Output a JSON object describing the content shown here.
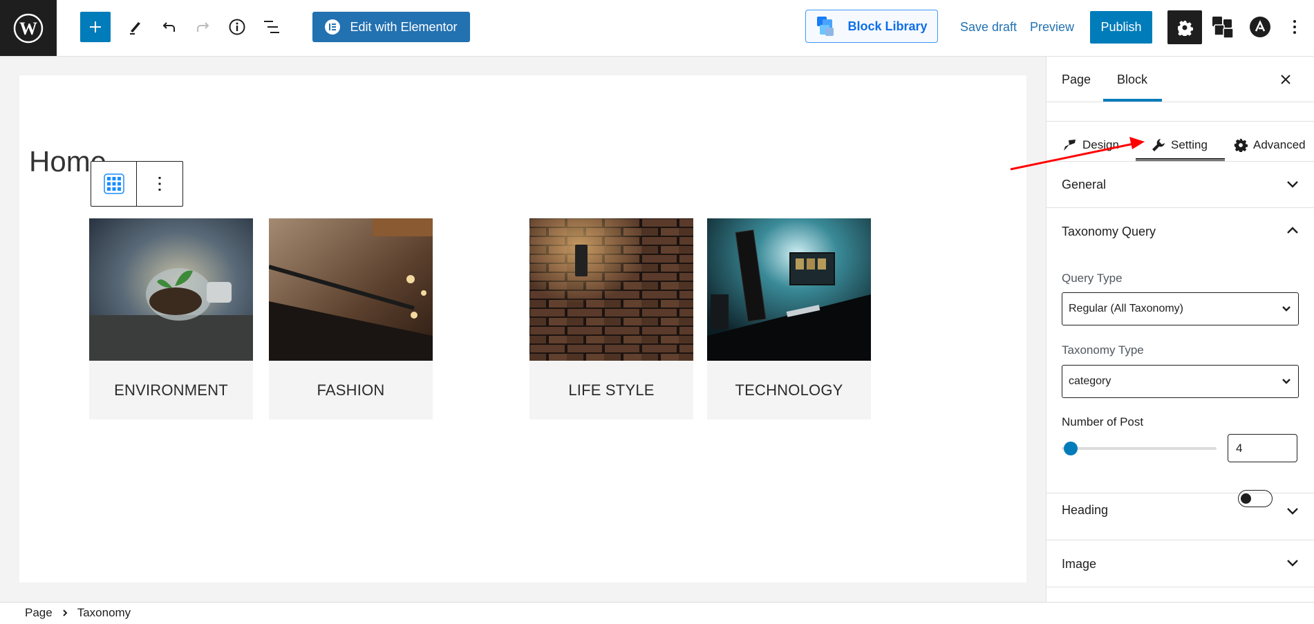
{
  "header": {
    "logo_icon": "wordpress-logo-icon",
    "toolbar_icons": [
      "plus-icon",
      "pen-icon",
      "undo-icon",
      "redo-icon",
      "info-icon",
      "list-view-icon"
    ],
    "elementor_label": "Edit with Elementor",
    "block_library_label": "Block Library",
    "save_draft_label": "Save draft",
    "preview_label": "Preview",
    "publish_label": "Publish",
    "right_icons": [
      "gear-icon",
      "blocks-icon",
      "astra-icon",
      "kebab-icon"
    ]
  },
  "canvas": {
    "page_title": "Home",
    "block_toolbar_icons": [
      "grid-icon",
      "more-vertical-icon"
    ],
    "cards": [
      {
        "label": "ENVIRONMENT",
        "image": "lightbulb-plant-photo"
      },
      {
        "label": "FASHION",
        "image": "clothing-rack-photo"
      },
      {
        "label": "LIFE STYLE",
        "image": "brick-wall-lamp-photo"
      },
      {
        "label": "TECHNOLOGY",
        "image": "desk-setup-photo"
      }
    ]
  },
  "sidebar": {
    "tabs": [
      {
        "label": "Page",
        "active": false
      },
      {
        "label": "Block",
        "active": true
      }
    ],
    "sub_tabs": [
      {
        "label": "Design",
        "icon": "brush-icon",
        "active": false
      },
      {
        "label": "Setting",
        "icon": "wrench-icon",
        "active": true
      },
      {
        "label": "Advanced",
        "icon": "gear-icon",
        "active": false
      }
    ],
    "panels": {
      "general": {
        "title": "General",
        "expanded": false
      },
      "taxonomy_query": {
        "title": "Taxonomy Query",
        "expanded": true,
        "query_type_label": "Query Type",
        "query_type_value": "Regular (All Taxonomy)",
        "taxonomy_type_label": "Taxonomy Type",
        "taxonomy_type_value": "category",
        "number_of_post_label": "Number of Post",
        "number_of_post_value": "4",
        "slider_fraction": 0.05
      },
      "heading": {
        "title": "Heading",
        "toggle_on": false,
        "expanded": false
      },
      "image": {
        "title": "Image",
        "expanded": false
      }
    }
  },
  "footer": {
    "breadcrumb": [
      "Page",
      "Taxonomy"
    ]
  },
  "colors": {
    "accent": "#007cba",
    "elementor": "#2271b1",
    "block_library": "#0e6ee6",
    "annotation_arrow": "#ff0000"
  }
}
